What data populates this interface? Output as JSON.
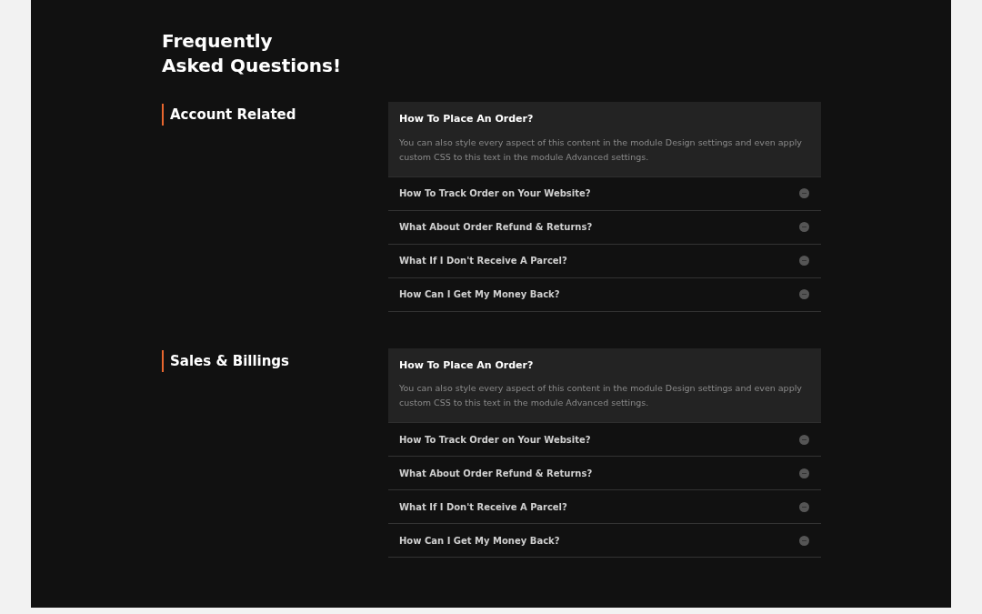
{
  "title": [
    "Frequently",
    "Asked Questions!"
  ],
  "sections": [
    {
      "heading": "Account Related",
      "items": [
        {
          "question": "How To Place An Order?",
          "expanded": true,
          "answer": "You can also style every aspect of this content in the module Design settings and even apply custom CSS to this text in the module Advanced settings."
        },
        {
          "question": "How To Track Order on Your Website?",
          "expanded": false
        },
        {
          "question": "What About Order Refund & Returns?",
          "expanded": false
        },
        {
          "question": "What If I Don't Receive A Parcel?",
          "expanded": false
        },
        {
          "question": "How Can I Get My Money Back?",
          "expanded": false
        }
      ]
    },
    {
      "heading": "Sales & Billings",
      "items": [
        {
          "question": "How To Place An Order?",
          "expanded": true,
          "answer": "You can also style every aspect of this content in the module Design settings and even apply custom CSS to this text in the module Advanced settings."
        },
        {
          "question": "How To Track Order on Your Website?",
          "expanded": false
        },
        {
          "question": "What About Order Refund & Returns?",
          "expanded": false
        },
        {
          "question": "What If I Don't Receive A Parcel?",
          "expanded": false
        },
        {
          "question": "How Can I Get My Money Back?",
          "expanded": false
        }
      ]
    }
  ]
}
